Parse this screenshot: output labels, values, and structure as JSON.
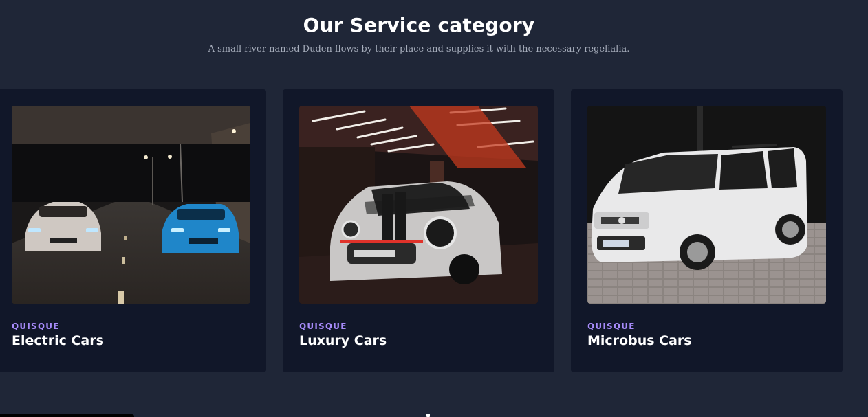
{
  "section": {
    "title": "Our Service category",
    "subtitle": "A small river named Duden flows by their place and supplies it with the necessary regelialia."
  },
  "cards": [
    {
      "category": "QUISQUE",
      "title": "Electric Cars",
      "image": "night-tunnel-two-sports-sedans"
    },
    {
      "category": "QUISQUE",
      "title": "Luxury Cars",
      "image": "mini-cooper-in-red-lit-garage"
    },
    {
      "category": "QUISQUE",
      "title": "Microbus Cars",
      "image": "white-van-on-paving"
    }
  ],
  "colors": {
    "background": "#1f2637",
    "card": "#111729",
    "accent": "#a78bfa",
    "text": "#ffffff",
    "muted": "#a6adbb"
  }
}
